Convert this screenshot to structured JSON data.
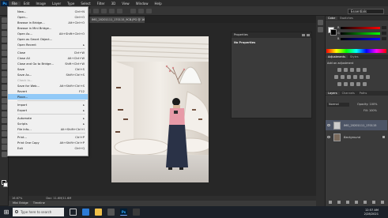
{
  "app": {
    "logo": "Ps"
  },
  "menubar": {
    "items": [
      "File",
      "Edit",
      "Image",
      "Layer",
      "Type",
      "Select",
      "Filter",
      "3D",
      "View",
      "Window",
      "Help"
    ]
  },
  "options": {
    "show_controls": "Show Transform Controls",
    "workspace": "Essentials"
  },
  "document": {
    "tab_title": "IMG_20201111_170115_9CB.JPG @ 16.7% (RGB/8)"
  },
  "file_menu": {
    "items": [
      {
        "label": "New...",
        "shortcut": "Ctrl+N",
        "disabled": false
      },
      {
        "label": "Open...",
        "shortcut": "Ctrl+O",
        "disabled": false
      },
      {
        "label": "Browse in Bridge...",
        "shortcut": "Alt+Ctrl+O",
        "disabled": false
      },
      {
        "label": "Browse in Mini Bridge...",
        "shortcut": "",
        "disabled": false
      },
      {
        "label": "Open As...",
        "shortcut": "Alt+Shift+Ctrl+O",
        "disabled": false
      },
      {
        "label": "Open as Smart Object...",
        "shortcut": "",
        "disabled": false
      },
      {
        "label": "Open Recent",
        "shortcut": "",
        "disabled": false,
        "submenu": true
      },
      {
        "label": "Close",
        "shortcut": "Ctrl+W",
        "disabled": false
      },
      {
        "label": "Close All",
        "shortcut": "Alt+Ctrl+W",
        "disabled": false
      },
      {
        "label": "Close and Go to Bridge...",
        "shortcut": "Shift+Ctrl+W",
        "disabled": false
      },
      {
        "label": "Save",
        "shortcut": "Ctrl+S",
        "disabled": false
      },
      {
        "label": "Save As...",
        "shortcut": "Shift+Ctrl+S",
        "disabled": false
      },
      {
        "label": "Check In...",
        "shortcut": "",
        "disabled": true
      },
      {
        "label": "Save for Web...",
        "shortcut": "Alt+Shift+Ctrl+S",
        "disabled": false
      },
      {
        "label": "Revert",
        "shortcut": "F12",
        "disabled": false
      },
      {
        "label": "Place...",
        "shortcut": "",
        "disabled": false,
        "highlight": true
      },
      {
        "label": "Import",
        "shortcut": "",
        "disabled": false,
        "submenu": true
      },
      {
        "label": "Export",
        "shortcut": "",
        "disabled": false,
        "submenu": true
      },
      {
        "label": "Automate",
        "shortcut": "",
        "disabled": false,
        "submenu": true
      },
      {
        "label": "Scripts",
        "shortcut": "",
        "disabled": false,
        "submenu": true
      },
      {
        "label": "File Info...",
        "shortcut": "Alt+Shift+Ctrl+I",
        "disabled": false
      },
      {
        "label": "Print...",
        "shortcut": "Ctrl+P",
        "disabled": false
      },
      {
        "label": "Print One Copy",
        "shortcut": "Alt+Shift+Ctrl+P",
        "disabled": false
      },
      {
        "label": "Exit",
        "shortcut": "Ctrl+Q",
        "disabled": false
      }
    ]
  },
  "properties": {
    "title": "Properties",
    "empty": "No Properties"
  },
  "status": {
    "zoom": "16.67%",
    "doc": "Doc: 11.6M/11.6M"
  },
  "timeline": {
    "tabs": [
      "Mini Bridge",
      "Timeline"
    ]
  },
  "color_panel": {
    "tabs": [
      "Color",
      "Swatches"
    ],
    "sliders": [
      {
        "label": "R",
        "gradient_end": "#ff0000"
      },
      {
        "label": "G",
        "gradient_end": "#00ff00"
      },
      {
        "label": "B",
        "gradient_end": "#0000ff"
      }
    ]
  },
  "adjustments": {
    "tabs": [
      "Adjustments",
      "Styles"
    ],
    "add_label": "Add an adjustment"
  },
  "layers": {
    "tabs": [
      "Layers",
      "Channels",
      "Paths"
    ],
    "mode": "Normal",
    "opacity": "Opacity: 100%",
    "fill": "Fill: 100%",
    "rows": [
      {
        "name": "IMG_20201111_170115",
        "selected": true
      },
      {
        "name": "Background",
        "selected": false
      }
    ]
  },
  "taskbar": {
    "search_placeholder": "Type here to search",
    "time": "12:57 AM",
    "date": "2/28/2021"
  }
}
